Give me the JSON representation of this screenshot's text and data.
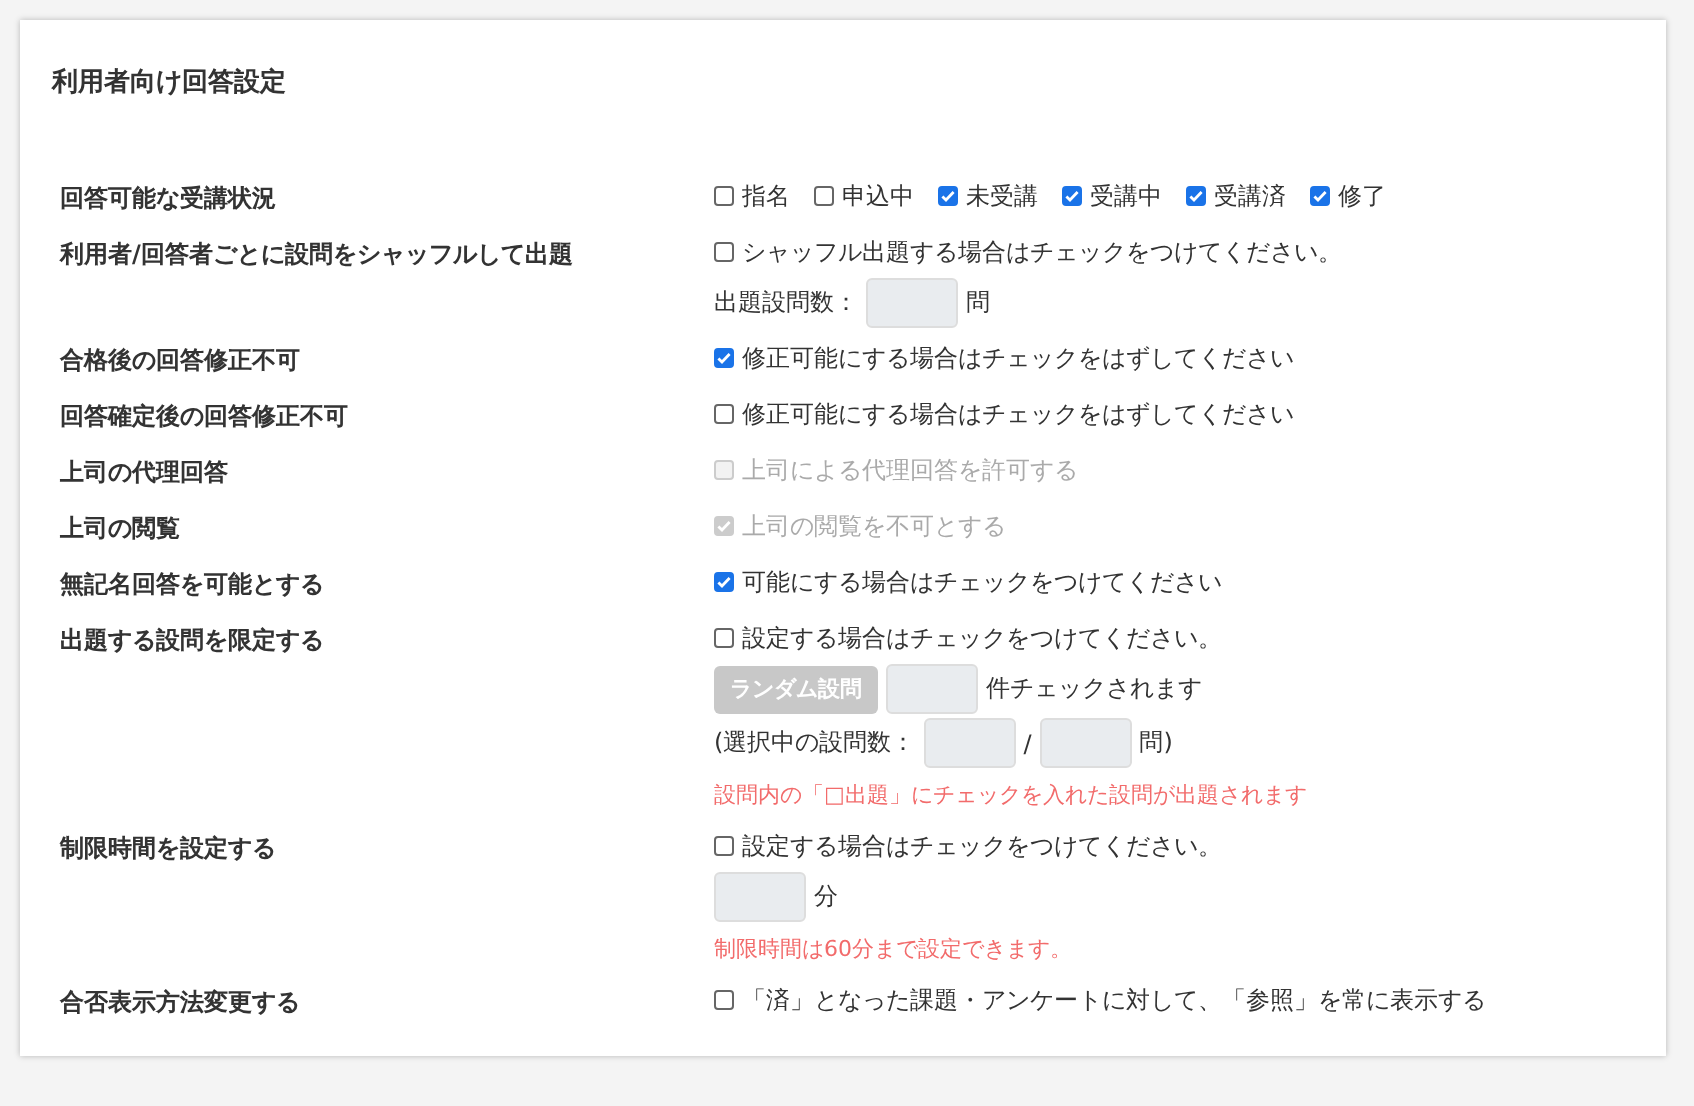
{
  "title": "利用者向け回答設定",
  "rows": [
    {
      "label": "回答可能な受講状況",
      "lines": [
        [
          {
            "kind": "checkbox",
            "label": "指名",
            "checked": false,
            "disabled": false
          },
          {
            "kind": "checkbox",
            "label": "申込中",
            "checked": false,
            "disabled": false
          },
          {
            "kind": "checkbox",
            "label": "未受講",
            "checked": true,
            "disabled": false
          },
          {
            "kind": "checkbox",
            "label": "受講中",
            "checked": true,
            "disabled": false
          },
          {
            "kind": "checkbox",
            "label": "受講済",
            "checked": true,
            "disabled": false
          },
          {
            "kind": "checkbox",
            "label": "修了",
            "checked": true,
            "disabled": false
          }
        ]
      ]
    },
    {
      "label": "利用者/回答者ごとに設問をシャッフルして出題",
      "lines": [
        [
          {
            "kind": "checkbox",
            "label": "シャッフル出題する場合はチェックをつけてください。",
            "checked": false,
            "disabled": false
          }
        ],
        [
          {
            "kind": "text",
            "text": "出題設問数："
          },
          {
            "kind": "field"
          },
          {
            "kind": "text",
            "text": "問"
          }
        ]
      ]
    },
    {
      "label": "合格後の回答修正不可",
      "lines": [
        [
          {
            "kind": "checkbox",
            "label": "修正可能にする場合はチェックをはずしてください",
            "checked": true,
            "disabled": false
          }
        ]
      ]
    },
    {
      "label": "回答確定後の回答修正不可",
      "lines": [
        [
          {
            "kind": "checkbox",
            "label": "修正可能にする場合はチェックをはずしてください",
            "checked": false,
            "disabled": false
          }
        ]
      ]
    },
    {
      "label": "上司の代理回答",
      "lines": [
        [
          {
            "kind": "checkbox",
            "label": "上司による代理回答を許可する",
            "checked": false,
            "disabled": true
          }
        ]
      ]
    },
    {
      "label": "上司の閲覧",
      "lines": [
        [
          {
            "kind": "checkbox",
            "label": "上司の閲覧を不可とする",
            "checked": true,
            "disabled": true
          }
        ]
      ]
    },
    {
      "label": "無記名回答を可能とする",
      "lines": [
        [
          {
            "kind": "checkbox",
            "label": "可能にする場合はチェックをつけてください",
            "checked": true,
            "disabled": false
          }
        ]
      ]
    },
    {
      "label": "出題する設問を限定する",
      "lines": [
        [
          {
            "kind": "checkbox",
            "label": "設定する場合はチェックをつけてください。",
            "checked": false,
            "disabled": false
          }
        ],
        [
          {
            "kind": "button",
            "label": "ランダム設問",
            "disabled": true
          },
          {
            "kind": "field"
          },
          {
            "kind": "text",
            "text": "件チェックされます"
          }
        ],
        [
          {
            "kind": "text",
            "text": "(選択中の設問数："
          },
          {
            "kind": "field"
          },
          {
            "kind": "text",
            "text": "/"
          },
          {
            "kind": "field"
          },
          {
            "kind": "text",
            "text": "問)"
          }
        ],
        [
          {
            "kind": "note",
            "text": "設問内の「□出題」にチェックを入れた設問が出題されます"
          }
        ]
      ]
    },
    {
      "label": "制限時間を設定する",
      "lines": [
        [
          {
            "kind": "checkbox",
            "label": "設定する場合はチェックをつけてください。",
            "checked": false,
            "disabled": false
          }
        ],
        [
          {
            "kind": "field"
          },
          {
            "kind": "text",
            "text": "分"
          }
        ],
        [
          {
            "kind": "note",
            "text": "制限時間は60分まで設定できます。"
          }
        ]
      ]
    },
    {
      "label": "合否表示方法変更する",
      "lines": [
        [
          {
            "kind": "checkbox",
            "label": "「済」となった課題・アンケートに対して、「参照」を常に表示する",
            "checked": false,
            "disabled": false
          }
        ]
      ]
    }
  ]
}
